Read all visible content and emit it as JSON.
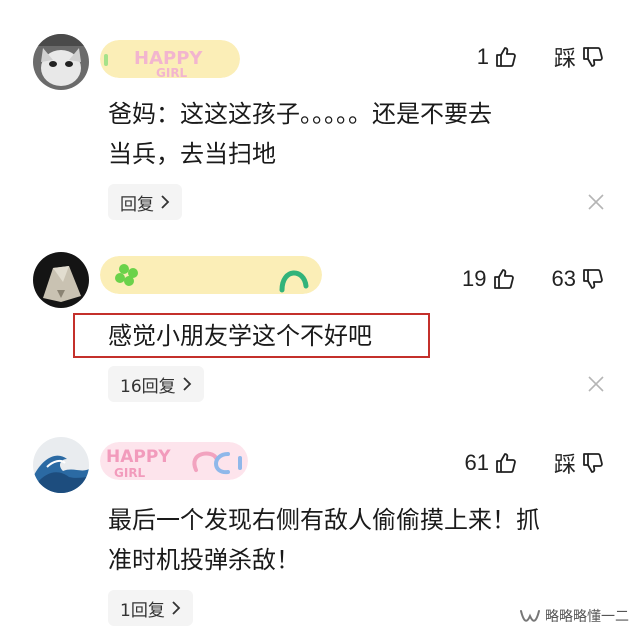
{
  "comments": [
    {
      "likes": "1",
      "dislike_label": "踩",
      "text_lines": [
        "爸妈：这这这孩子。。。。。还是不要去",
        "当兵，去当扫地"
      ],
      "reply_label": "回复",
      "avatar": "cat-avatar",
      "sticker": "happy-girl-sticker"
    },
    {
      "likes": "19",
      "dislikes": "63",
      "text_lines": [
        "感觉小朋友学这个不好吧"
      ],
      "reply_label": "16回复",
      "avatar": "sculpture-avatar",
      "sticker": "clover-sticker"
    },
    {
      "likes": "61",
      "dislike_label": "踩",
      "text_lines": [
        "最后一个发现右侧有敌人偷偷摸上来！抓",
        "准时机投弹杀敌！"
      ],
      "reply_label": "1回复",
      "avatar": "wave-avatar",
      "sticker": "happy-girl-sticker"
    }
  ],
  "watermark": {
    "text": "略略略懂一二",
    "icon": "wechat-channel-icon"
  },
  "icons": {
    "like": "thumbs-up-icon",
    "dislike": "thumbs-down-icon",
    "close": "close-icon",
    "chevron": "chevron-right-icon"
  },
  "colors": {
    "highlight_border": "#c4302b",
    "reply_pill_bg": "#f4f4f4"
  }
}
